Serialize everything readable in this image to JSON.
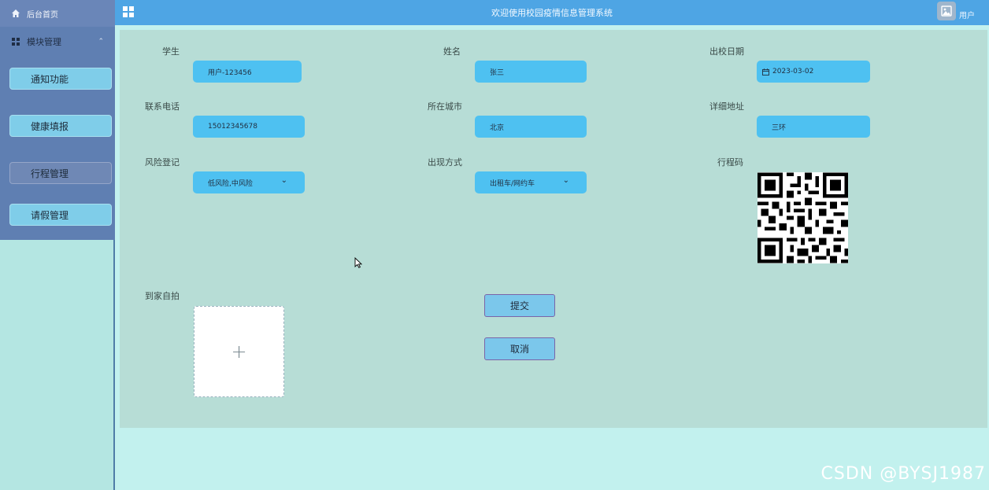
{
  "header": {
    "title": "欢迎使用校园疫情信息管理系统",
    "user_label": "用户"
  },
  "sidebar": {
    "home_label": "后台首页",
    "modules_label": "模块管理",
    "items": [
      {
        "label": "通知功能"
      },
      {
        "label": "健康填报"
      },
      {
        "label": "行程管理"
      },
      {
        "label": "请假管理"
      }
    ]
  },
  "form": {
    "student_label": "学生",
    "student_value": "用户-123456",
    "name_label": "姓名",
    "name_value": "张三",
    "date_label": "出校日期",
    "date_value": "2023-03-02",
    "phone_label": "联系电话",
    "phone_value": "15012345678",
    "city_label": "所在城市",
    "city_value": "北京",
    "address_label": "详细地址",
    "address_value": "三环",
    "risk_label": "风险登记",
    "risk_value": "低风险,中风险",
    "transport_label": "出现方式",
    "transport_value": "出租车/网约车",
    "trip_code_label": "行程码",
    "selfie_label": "到家自拍",
    "upload_plus": "+",
    "submit_label": "提交",
    "cancel_label": "取消"
  },
  "watermark": "CSDN @BYSJ1987"
}
